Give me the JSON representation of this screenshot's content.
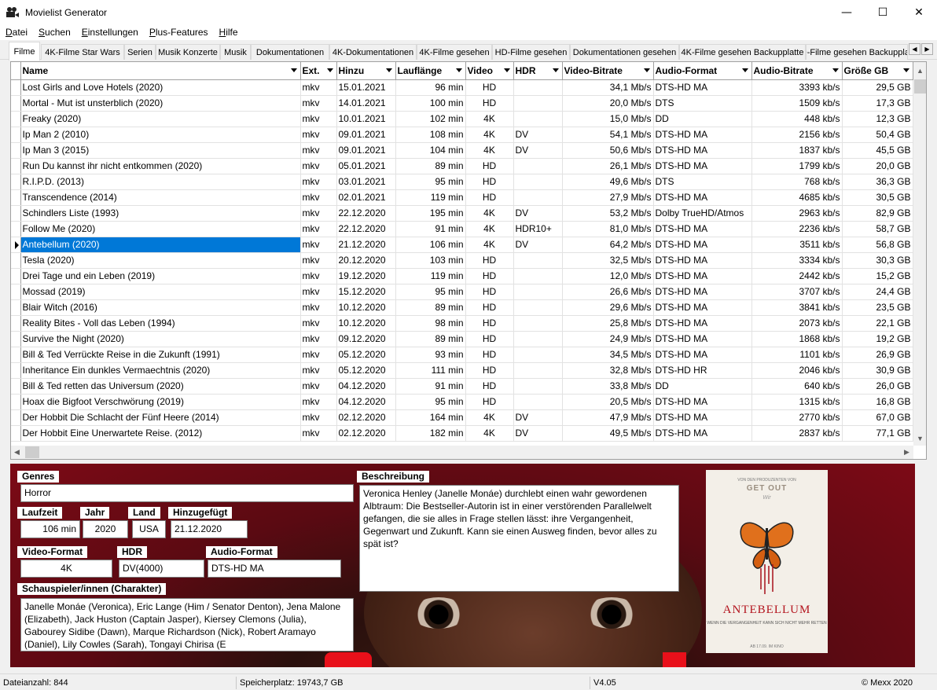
{
  "window": {
    "title": "Movielist Generator",
    "minimize": "—",
    "maximize": "☐",
    "close": "✕"
  },
  "menu": [
    {
      "key": "D",
      "rest": "atei"
    },
    {
      "key": "S",
      "rest": "uchen"
    },
    {
      "key": "E",
      "rest": "instellungen"
    },
    {
      "key": "P",
      "rest": "lus-Features"
    },
    {
      "key": "H",
      "rest": "ilfe"
    }
  ],
  "tabs": [
    "Filme",
    "4K-Filme Star Wars",
    "Serien",
    "Musik Konzerte",
    "Musik",
    "Dokumentationen",
    "4K-Dokumentationen",
    "4K-Filme gesehen",
    "HD-Filme gesehen",
    "Dokumentationen gesehen",
    "4K-Filme gesehen Backupplatte",
    "HD-Filme gesehen Backupplatte"
  ],
  "tab_scroll": {
    "left": "◀",
    "right": "▶"
  },
  "columns": [
    "Name",
    "Ext.",
    "Hinzu",
    "Lauflänge",
    "Video",
    "HDR",
    "Video-Bitrate",
    "Audio-Format",
    "Audio-Bitrate",
    "Größe GB"
  ],
  "rows": [
    [
      "Lost Girls and Love Hotels (2020)",
      "mkv",
      "15.01.2021",
      "96 min",
      "HD",
      "",
      "34,1 Mb/s",
      "DTS-HD MA",
      "3393 kb/s",
      "29,5 GB"
    ],
    [
      "Mortal - Mut ist unsterblich (2020)",
      "mkv",
      "14.01.2021",
      "100 min",
      "HD",
      "",
      "20,0 Mb/s",
      "DTS",
      "1509 kb/s",
      "17,3 GB"
    ],
    [
      "Freaky (2020)",
      "mkv",
      "10.01.2021",
      "102 min",
      "4K",
      "",
      "15,0 Mb/s",
      "DD",
      "448 kb/s",
      "12,3 GB"
    ],
    [
      "Ip Man 2 (2010)",
      "mkv",
      "09.01.2021",
      "108 min",
      "4K",
      "DV",
      "54,1 Mb/s",
      "DTS-HD MA",
      "2156 kb/s",
      "50,4 GB"
    ],
    [
      "Ip Man 3 (2015)",
      "mkv",
      "09.01.2021",
      "104 min",
      "4K",
      "DV",
      "50,6 Mb/s",
      "DTS-HD MA",
      "1837 kb/s",
      "45,5 GB"
    ],
    [
      "Run Du kannst ihr nicht entkommen (2020)",
      "mkv",
      "05.01.2021",
      "89 min",
      "HD",
      "",
      "26,1 Mb/s",
      "DTS-HD MA",
      "1799 kb/s",
      "20,0 GB"
    ],
    [
      "R.I.P.D. (2013)",
      "mkv",
      "03.01.2021",
      "95 min",
      "HD",
      "",
      "49,6 Mb/s",
      "DTS",
      "768 kb/s",
      "36,3 GB"
    ],
    [
      "Transcendence (2014)",
      "mkv",
      "02.01.2021",
      "119 min",
      "HD",
      "",
      "27,9 Mb/s",
      "DTS-HD MA",
      "4685 kb/s",
      "30,5 GB"
    ],
    [
      "Schindlers Liste (1993)",
      "mkv",
      "22.12.2020",
      "195 min",
      "4K",
      "DV",
      "53,2 Mb/s",
      "Dolby TrueHD/Atmos",
      "2963 kb/s",
      "82,9 GB"
    ],
    [
      "Follow Me (2020)",
      "mkv",
      "22.12.2020",
      "91 min",
      "4K",
      "HDR10+",
      "81,0 Mb/s",
      "DTS-HD MA",
      "2236 kb/s",
      "58,7 GB"
    ],
    [
      "Antebellum (2020)",
      "mkv",
      "21.12.2020",
      "106 min",
      "4K",
      "DV",
      "64,2 Mb/s",
      "DTS-HD MA",
      "3511 kb/s",
      "56,8 GB"
    ],
    [
      "Tesla (2020)",
      "mkv",
      "20.12.2020",
      "103 min",
      "HD",
      "",
      "32,5 Mb/s",
      "DTS-HD MA",
      "3334 kb/s",
      "30,3 GB"
    ],
    [
      "Drei Tage und ein Leben (2019)",
      "mkv",
      "19.12.2020",
      "119 min",
      "HD",
      "",
      "12,0 Mb/s",
      "DTS-HD MA",
      "2442 kb/s",
      "15,2 GB"
    ],
    [
      "Mossad (2019)",
      "mkv",
      "15.12.2020",
      "95 min",
      "HD",
      "",
      "26,6 Mb/s",
      "DTS-HD MA",
      "3707 kb/s",
      "24,4 GB"
    ],
    [
      "Blair Witch (2016)",
      "mkv",
      "10.12.2020",
      "89 min",
      "HD",
      "",
      "29,6 Mb/s",
      "DTS-HD MA",
      "3841 kb/s",
      "23,5 GB"
    ],
    [
      "Reality Bites - Voll das Leben (1994)",
      "mkv",
      "10.12.2020",
      "98 min",
      "HD",
      "",
      "25,8 Mb/s",
      "DTS-HD MA",
      "2073 kb/s",
      "22,1 GB"
    ],
    [
      "Survive the Night (2020)",
      "mkv",
      "09.12.2020",
      "89 min",
      "HD",
      "",
      "24,9 Mb/s",
      "DTS-HD MA",
      "1868 kb/s",
      "19,2 GB"
    ],
    [
      "Bill & Ted Verrückte Reise in die Zukunft (1991)",
      "mkv",
      "05.12.2020",
      "93 min",
      "HD",
      "",
      "34,5 Mb/s",
      "DTS-HD MA",
      "1101 kb/s",
      "26,9 GB"
    ],
    [
      "Inheritance Ein dunkles Vermaechtnis (2020)",
      "mkv",
      "05.12.2020",
      "111 min",
      "HD",
      "",
      "32,8 Mb/s",
      "DTS-HD HR",
      "2046 kb/s",
      "30,9 GB"
    ],
    [
      "Bill & Ted retten das Universum (2020)",
      "mkv",
      "04.12.2020",
      "91 min",
      "HD",
      "",
      "33,8 Mb/s",
      "DD",
      "640 kb/s",
      "26,0 GB"
    ],
    [
      "Hoax die Bigfoot Verschwörung (2019)",
      "mkv",
      "04.12.2020",
      "95 min",
      "HD",
      "",
      "20,5 Mb/s",
      "DTS-HD MA",
      "1315 kb/s",
      "16,8 GB"
    ],
    [
      "Der Hobbit Die Schlacht der Fünf Heere (2014)",
      "mkv",
      "02.12.2020",
      "164 min",
      "4K",
      "DV",
      "47,9 Mb/s",
      "DTS-HD MA",
      "2770 kb/s",
      "67,0 GB"
    ],
    [
      "Der Hobbit Eine Unerwartete Reise. (2012)",
      "mkv",
      "02.12.2020",
      "182 min",
      "4K",
      "DV",
      "49,5 Mb/s",
      "DTS-HD MA",
      "2837 kb/s",
      "77,1 GB"
    ]
  ],
  "scroll": {
    "up": "▲",
    "down": "▼",
    "left": "◀",
    "right": "▶"
  },
  "detail": {
    "genres_label": "Genres",
    "genres": "Horror",
    "laufzeit_label": "Laufzeit",
    "laufzeit": "106 min",
    "jahr_label": "Jahr",
    "jahr": "2020",
    "land_label": "Land",
    "land": "USA",
    "hinzu_label": "Hinzugefügt",
    "hinzu": "21.12.2020",
    "vformat_label": "Video-Format",
    "vformat": "4K",
    "hdr_label": "HDR",
    "hdr": "DV(4000)",
    "aformat_label": "Audio-Format",
    "aformat": "DTS-HD MA",
    "cast_label": "Schauspieler/innen (Charakter)",
    "cast": "Janelle Monáe (Veronica), Eric Lange (Him / Senator Denton), Jena Malone (Elizabeth), Jack Huston (Captain Jasper), Kiersey Clemons (Julia), Gabourey Sidibe (Dawn), Marque Richardson (Nick), Robert Aramayo (Daniel), Lily Cowles (Sarah), Tongayi Chirisa (E",
    "desc_label": "Beschreibung",
    "desc": "Veronica Henley (Janelle Monáe) durchlebt einen wahr gewordenen Albtraum: Die Bestseller-Autorin ist in einer verstörenden Parallelwelt gefangen, die sie alles in Frage stellen lässt: ihre Vergangenheit, Gegenwart und Zukunft. Kann sie einen Ausweg finden, bevor alles zu spät ist?"
  },
  "poster": {
    "top": "VON DEN PRODUZENTEN VON",
    "getout": "GET OUT",
    "us": "Wir",
    "title": "ANTEBELLUM",
    "sub": "WENN DIE VERGANGENHEIT KANN SICH NICHT MEHR RETTEN",
    "foot": "AB 17.09. IM KINO"
  },
  "status": {
    "count": "Dateianzahl: 844",
    "space": "Speicherplatz: 19743,7 GB",
    "version": "V4.05",
    "copyright": "© Mexx 2020"
  },
  "colors": {
    "selection": "#0078d7",
    "poster_title": "#b3141e"
  }
}
